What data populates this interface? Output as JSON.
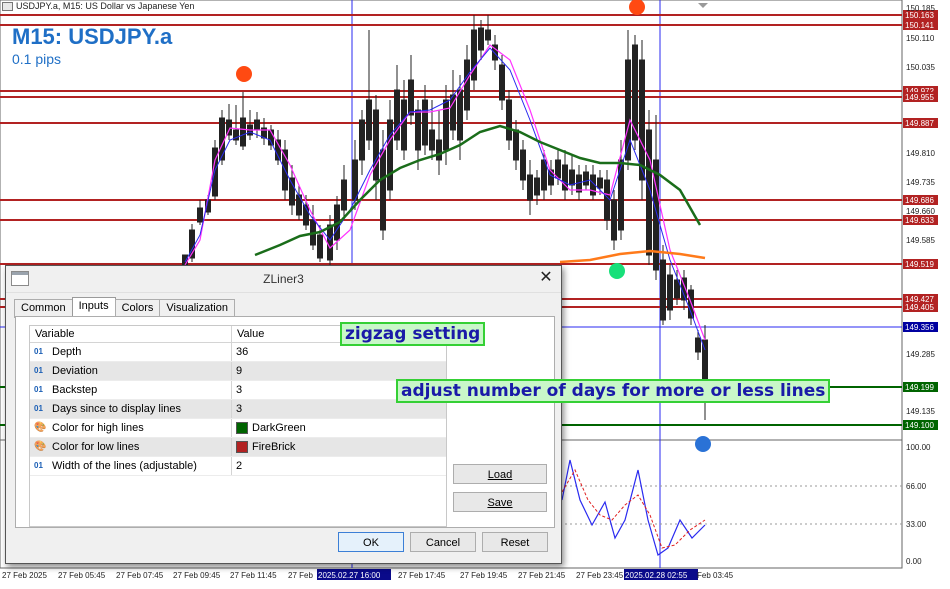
{
  "chart": {
    "header": "USDJPY.a, M15:  US Dollar vs Japanese Yen",
    "title": "M15: USDJPY.a",
    "subtitle": "0.1 pips",
    "price_ticks": [
      "150.185",
      "150.110",
      "150.035",
      "149.810",
      "149.735",
      "149.660",
      "149.585",
      "149.285",
      "149.135"
    ],
    "level_labels": [
      {
        "text": "150.163",
        "color": "#b22222"
      },
      {
        "text": "150.141",
        "color": "#b22222"
      },
      {
        "text": "149.972",
        "color": "#b22222"
      },
      {
        "text": "149.955",
        "color": "#b22222"
      },
      {
        "text": "149.887",
        "color": "#b22222"
      },
      {
        "text": "149.686",
        "color": "#b22222"
      },
      {
        "text": "149.633",
        "color": "#b22222"
      },
      {
        "text": "149.519",
        "color": "#b22222"
      },
      {
        "text": "149.427",
        "color": "#b22222"
      },
      {
        "text": "149.405",
        "color": "#b22222"
      },
      {
        "text": "149.356",
        "color": "#0000a0"
      },
      {
        "text": "149.199",
        "color": "#006400"
      },
      {
        "text": "149.100",
        "color": "#006400"
      }
    ],
    "osc_ticks": [
      "100.00",
      "66.00",
      "33.00",
      "0.00"
    ],
    "time_labels": [
      "27 Feb 2025",
      "27 Feb 05:45",
      "27 Feb 07:45",
      "27 Feb 09:45",
      "27 Feb 11:45",
      "27 Feb",
      "2025.02.27 16:00",
      "27 Feb 17:45",
      "27 Feb 19:45",
      "27 Feb 21:45",
      "27 Feb 23:45",
      "2025.02.28 02:55",
      "Feb 03:45"
    ]
  },
  "dialog": {
    "title": "ZLiner3",
    "close": "✕",
    "tabs": [
      "Common",
      "Inputs",
      "Colors",
      "Visualization"
    ],
    "active_tab": "Inputs",
    "columns": {
      "variable": "Variable",
      "value": "Value"
    },
    "rows": [
      {
        "type": "01",
        "variable": "Depth",
        "value": "36"
      },
      {
        "type": "01",
        "variable": "Deviation",
        "value": "9"
      },
      {
        "type": "01",
        "variable": "Backstep",
        "value": "3"
      },
      {
        "type": "01",
        "variable": "Days since to display lines",
        "value": "3"
      },
      {
        "type": "color",
        "variable": "Color for high lines",
        "value": "DarkGreen",
        "swatch": "#006400"
      },
      {
        "type": "color",
        "variable": "Color for low lines",
        "value": "FireBrick",
        "swatch": "#b22222"
      },
      {
        "type": "01",
        "variable": "Width of the lines (adjustable)",
        "value": "2"
      }
    ],
    "buttons": {
      "load": "Load",
      "save": "Save",
      "ok": "OK",
      "cancel": "Cancel",
      "reset": "Reset"
    }
  },
  "annotations": {
    "zigzag": "zigzag setting",
    "days": "adjust number of days for more or less lines"
  }
}
